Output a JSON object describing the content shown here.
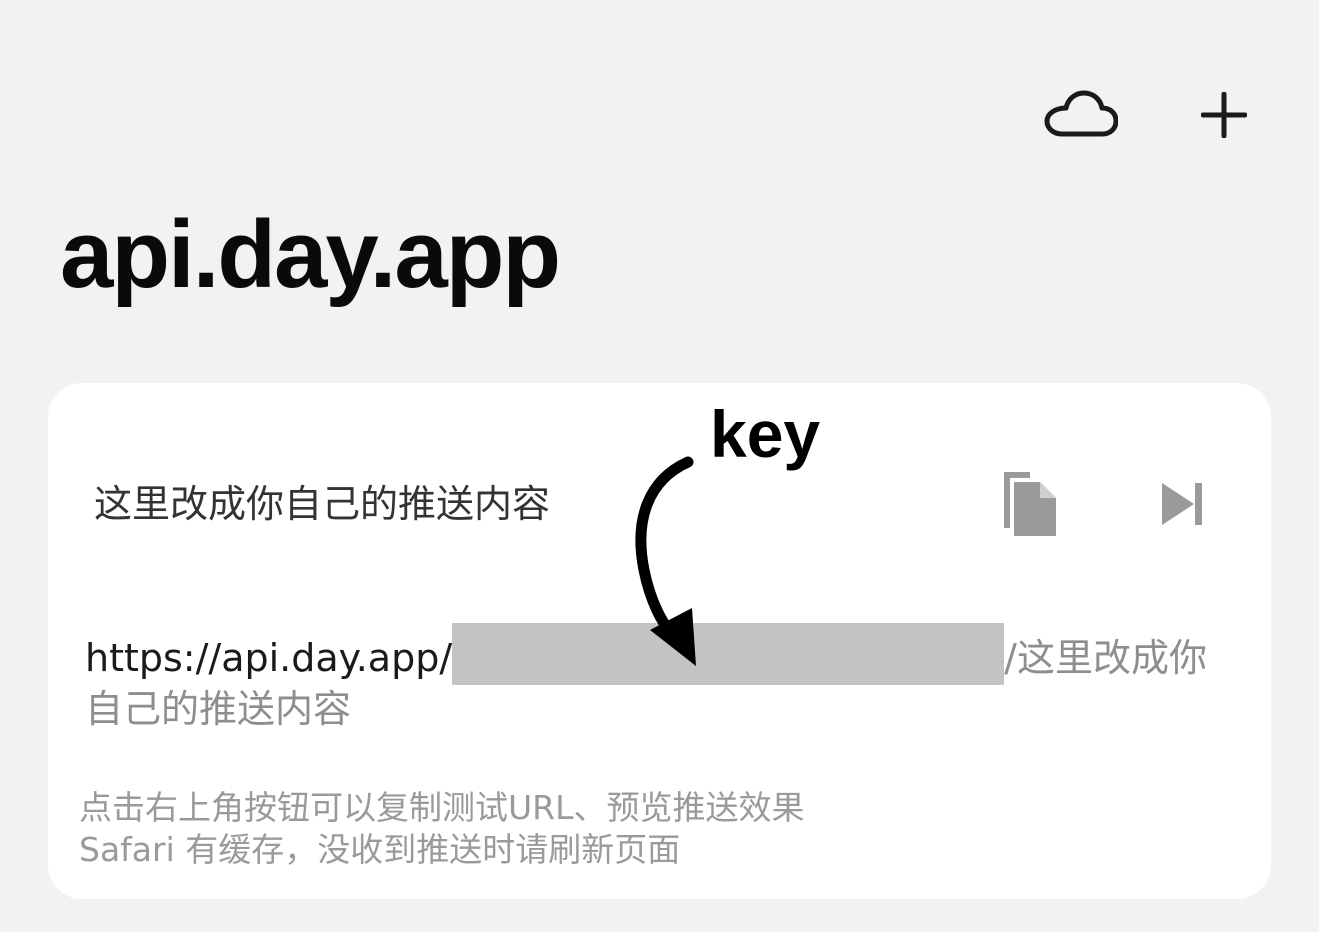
{
  "header": {
    "title": "api.day.app",
    "cloud_icon": "cloud-icon",
    "add_icon": "plus-icon"
  },
  "card": {
    "message": "这里改成你自己的推送内容",
    "copy_icon": "copy-icon",
    "preview_icon": "skip-forward-icon",
    "url_prefix": "https://api.day.app/",
    "url_suffix": "/这里改成你自己的推送内容",
    "hint_line1": "点击右上角按钮可以复制测试URL、预览推送效果",
    "hint_line2": "Safari 有缓存，没收到推送时请刷新页面"
  },
  "annotation": {
    "label": "key"
  },
  "colors": {
    "background": "#f2f2f2",
    "card": "#ffffff",
    "key_mask": "#c3c3c3",
    "icon_gray": "#9a9a9a"
  }
}
